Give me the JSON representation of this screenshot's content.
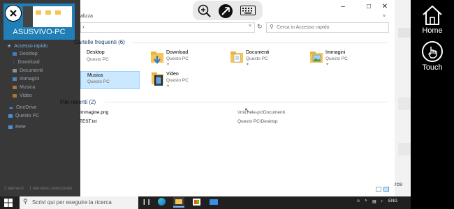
{
  "session": {
    "name": "ASUSVIVO-PC"
  },
  "remote_panel": {
    "home_label": "Home",
    "touch_label": "Touch"
  },
  "explorer": {
    "title_fragment": "alizza",
    "search_placeholder": "Cerca in Accesso rapido",
    "nav_items": [
      "Accesso rapido",
      "Desktop",
      "Download",
      "Documenti",
      "Immagini",
      "Musica",
      "Video",
      "OneDrive",
      "Questo PC",
      "Rete"
    ],
    "frequent": {
      "heading": "Cartelle frequenti (6)",
      "tiles": [
        {
          "name": "Desktop",
          "sub": "Questo PC"
        },
        {
          "name": "Download",
          "sub": "Questo PC"
        },
        {
          "name": "Documenti",
          "sub": "Questo PC"
        },
        {
          "name": "Immagini",
          "sub": "Questo PC"
        },
        {
          "name": "Musica",
          "sub": "Questo PC"
        },
        {
          "name": "Video",
          "sub": "Questo PC"
        }
      ]
    },
    "recent": {
      "heading": "File recenti (2)",
      "files": [
        {
          "name": "Immagine.png",
          "path": "\\\\michele-pc\\Documenti"
        },
        {
          "name": "TEST.txt",
          "path": "Questo PC\\Desktop"
        }
      ]
    },
    "status": {
      "count": "2 elementi",
      "selected": "1 elemento selezionato"
    }
  },
  "taskbar": {
    "search_text": "Scrivi qui per eseguire la ricerca",
    "lang": "ENG",
    "bg_fragment": "rce"
  },
  "colors": {
    "accent": "#1f7fb6",
    "selection": "#cce8ff",
    "folder": "#f5c451"
  }
}
